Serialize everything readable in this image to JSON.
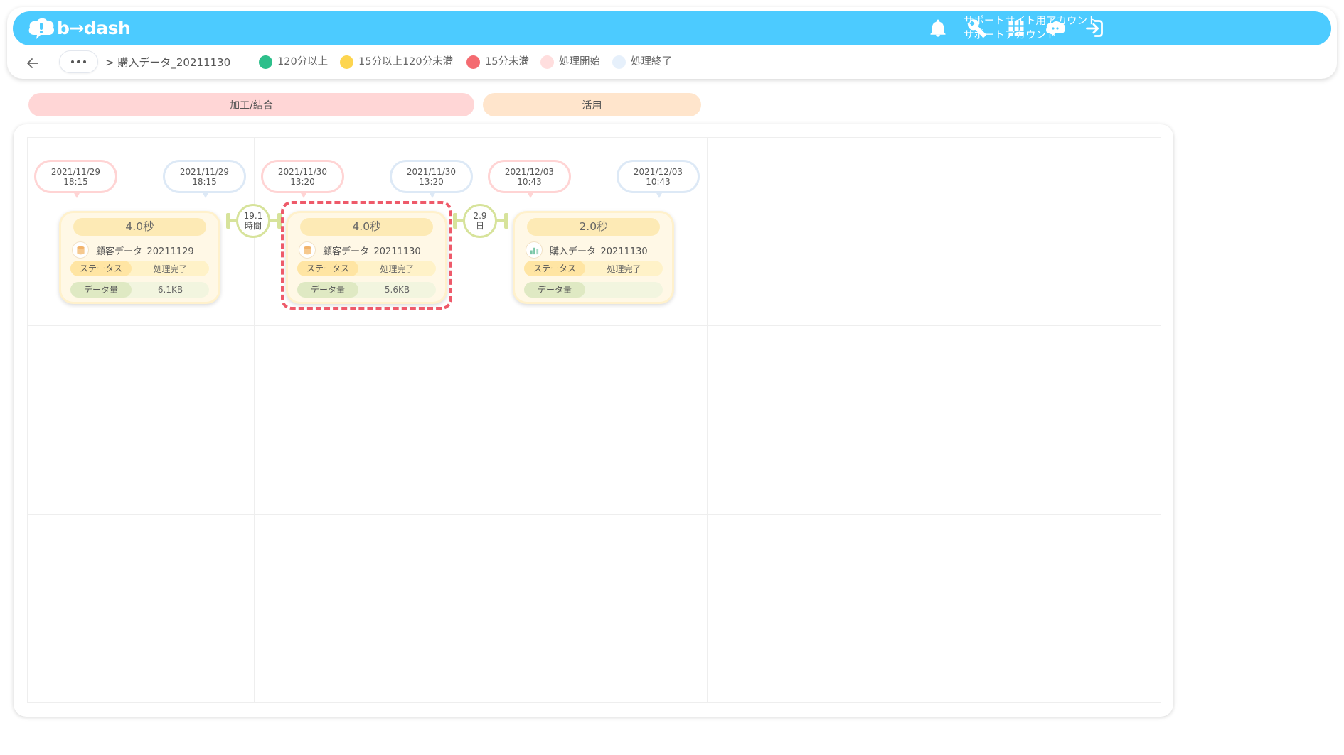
{
  "header": {
    "logo_text": "b→dash",
    "account_line1": "サポートサイト用アカウント",
    "account_line2": "サポートアカウント",
    "icons": [
      "bell-icon",
      "wrench-icon",
      "apps-grid-icon",
      "chat-bot-icon",
      "logout-icon"
    ]
  },
  "breadcrumb": {
    "separator": ">",
    "current": "購入データ_20211130"
  },
  "legend": [
    {
      "label": "120分以上",
      "color": "#2dbf8b"
    },
    {
      "label": "15分以上120分未満",
      "color": "#fdd54f"
    },
    {
      "label": "15分未満",
      "color": "#f46b71"
    },
    {
      "label": "処理開始",
      "color": "#ffdede"
    },
    {
      "label": "処理終了",
      "color": "#e6f0fb"
    }
  ],
  "phases": [
    {
      "label": "加工/結合",
      "color": "#ffd6d6"
    },
    {
      "label": "活用",
      "color": "#ffe5cc"
    }
  ],
  "nodes": [
    {
      "start_date": "2021/11/29",
      "start_time": "18:15",
      "end_date": "2021/11/29",
      "end_time": "18:15",
      "duration": "4.0秒",
      "name": "顧客データ_20211129",
      "icon": "database-icon",
      "status_key": "ステータス",
      "status_value": "処理完了",
      "size_key": "データ量",
      "size_value": "6.1KB"
    },
    {
      "start_date": "2021/11/30",
      "start_time": "13:20",
      "end_date": "2021/11/30",
      "end_time": "13:20",
      "duration": "4.0秒",
      "name": "顧客データ_20211130",
      "icon": "database-icon",
      "status_key": "ステータス",
      "status_value": "処理完了",
      "size_key": "データ量",
      "size_value": "5.6KB"
    },
    {
      "start_date": "2021/12/03",
      "start_time": "10:43",
      "end_date": "2021/12/03",
      "end_time": "10:43",
      "duration": "2.0秒",
      "name": "購入データ_20211130",
      "icon": "chart-icon",
      "status_key": "ステータス",
      "status_value": "処理完了",
      "size_key": "データ量",
      "size_value": "-"
    }
  ],
  "gaps": [
    {
      "value": "19.1",
      "unit": "時間"
    },
    {
      "value": "2.9",
      "unit": "日"
    }
  ]
}
